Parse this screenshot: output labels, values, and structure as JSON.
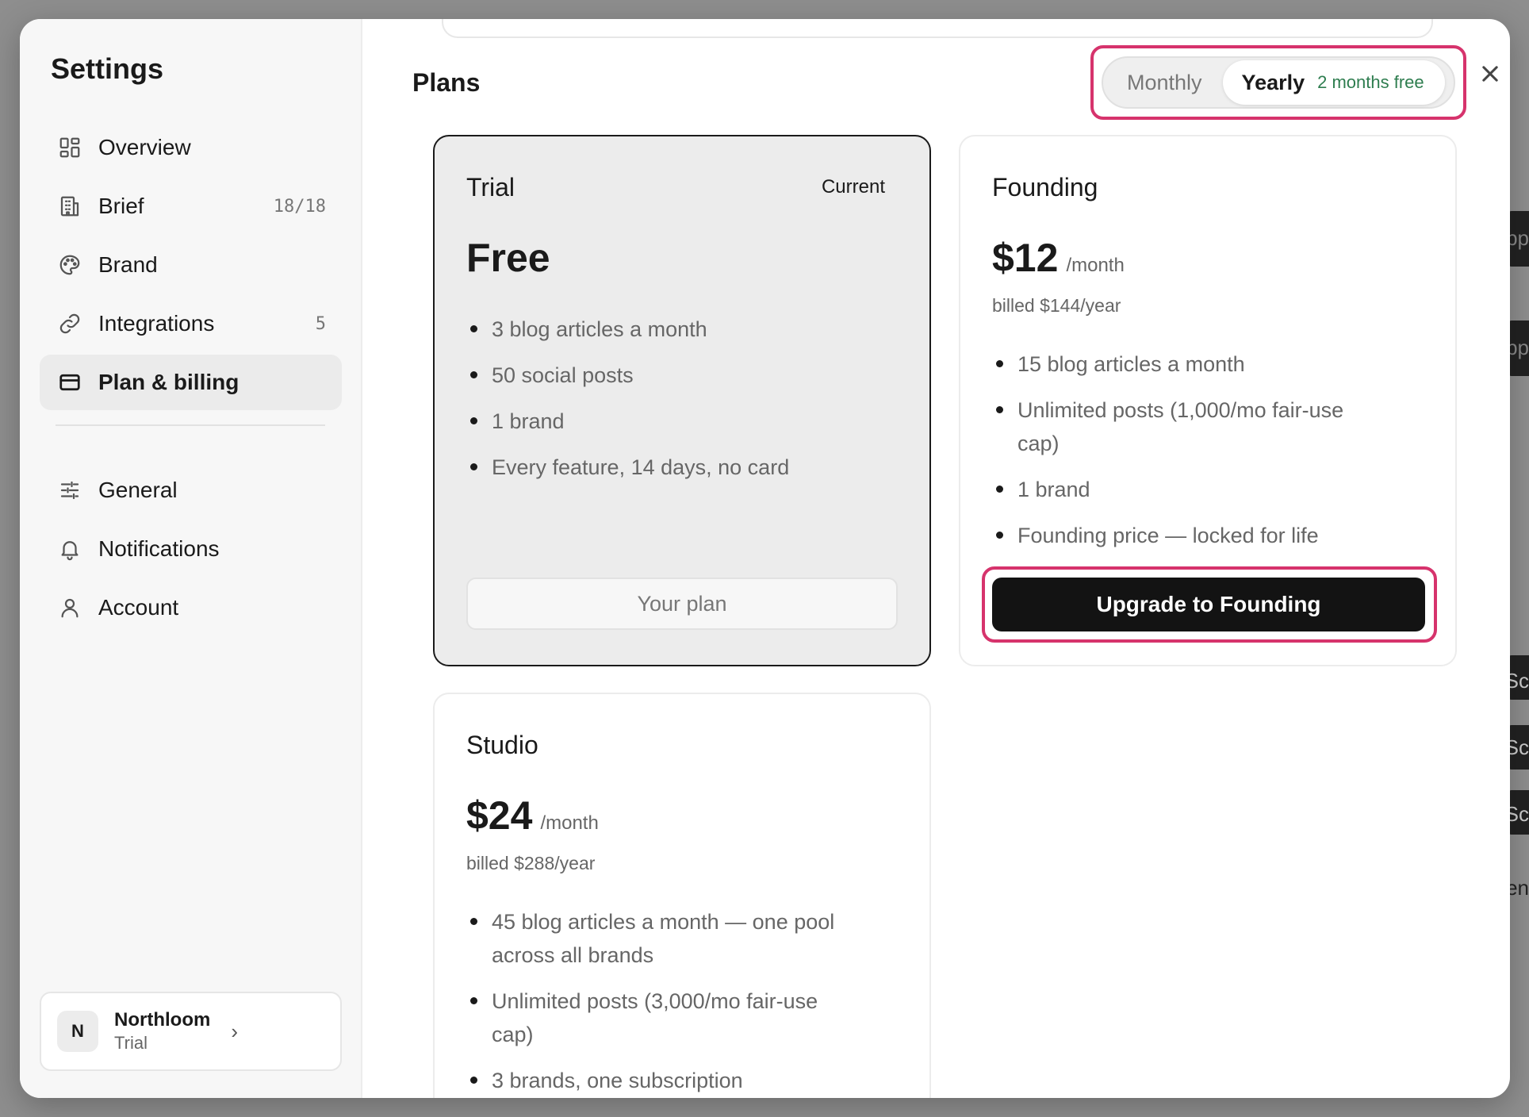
{
  "background": {
    "peek_texts": [
      "pp",
      "pp",
      "Sc",
      "Sc",
      "Sc",
      "en"
    ]
  },
  "sidebar": {
    "title": "Settings",
    "items": [
      {
        "label": "Overview",
        "icon": "grid-icon",
        "count": ""
      },
      {
        "label": "Brief",
        "icon": "building-icon",
        "count": "18/18"
      },
      {
        "label": "Brand",
        "icon": "palette-icon",
        "count": ""
      },
      {
        "label": "Integrations",
        "icon": "link-icon",
        "count": "5"
      },
      {
        "label": "Plan & billing",
        "icon": "credit-card-icon",
        "count": "",
        "active": true
      },
      {
        "label": "General",
        "icon": "sliders-icon",
        "count": ""
      },
      {
        "label": "Notifications",
        "icon": "bell-icon",
        "count": ""
      },
      {
        "label": "Account",
        "icon": "user-icon",
        "count": ""
      }
    ],
    "workspace": {
      "initial": "N",
      "name": "Northloom",
      "plan": "Trial"
    }
  },
  "main": {
    "title": "Plans",
    "billing_toggle": {
      "monthly_label": "Monthly",
      "yearly_label": "Yearly",
      "yearly_badge": "2 months free",
      "selected": "Yearly"
    },
    "plans": [
      {
        "name": "Trial",
        "badge": "Current",
        "price": "Free",
        "features": [
          "3 blog articles a month",
          "50 social posts",
          "1 brand",
          "Every feature, 14 days, no card"
        ],
        "button_label": "Your plan"
      },
      {
        "name": "Founding",
        "price": "$12",
        "per": "/month",
        "billed": "billed $144/year",
        "features": [
          "15 blog articles a month",
          "Unlimited posts (1,000/mo fair-use cap)",
          "1 brand",
          "Founding price — locked for life"
        ],
        "button_label": "Upgrade to Founding"
      },
      {
        "name": "Studio",
        "price": "$24",
        "per": "/month",
        "billed": "billed $288/year",
        "features": [
          "45 blog articles a month — one pool across all brands",
          "Unlimited posts (3,000/mo fair-use cap)",
          "3 brands, one subscription"
        ]
      }
    ]
  },
  "colors": {
    "highlight": "#d6336c",
    "accent_green": "#2e7d4f",
    "primary_button": "#131313"
  }
}
